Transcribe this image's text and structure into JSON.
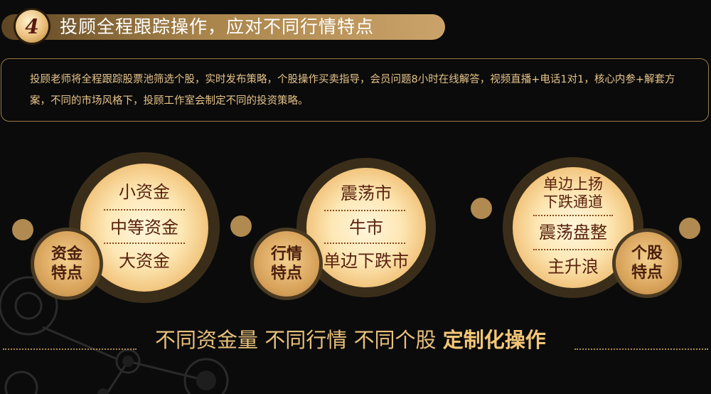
{
  "header": {
    "step_number": "4",
    "title": "投顾全程跟踪操作，应对不同行情特点"
  },
  "description": {
    "text": "投顾老师将全程跟踪股票池筛选个股，实时发布策略，个股操作买卖指导，会员问题8小时在线解答，视频直播+电话1对1，核心内参+解套方案，不同的市场风格下，投顾工作室会制定不同的投资策略。"
  },
  "groups": [
    {
      "feature_line1": "资金",
      "feature_line2": "特点",
      "items": [
        "小资金",
        "中等资金",
        "大资金"
      ]
    },
    {
      "feature_line1": "行情",
      "feature_line2": "特点",
      "items": [
        "震荡市",
        "牛市",
        "单边下跌市"
      ]
    },
    {
      "feature_line1": "个股",
      "feature_line2": "特点",
      "items": [
        "单边上扬\n下跌通道",
        "震荡盘整",
        "主升浪"
      ]
    }
  ],
  "tagline": {
    "part1": "不同资金量",
    "part2": "不同行情",
    "part3": "不同个股",
    "emphasis": "定制化操作"
  },
  "colors": {
    "background": "#0b0b0b",
    "gold_accent": "#caa36a",
    "text_gold": "#e8c07c",
    "dark_brown_text": "#5a220e"
  }
}
